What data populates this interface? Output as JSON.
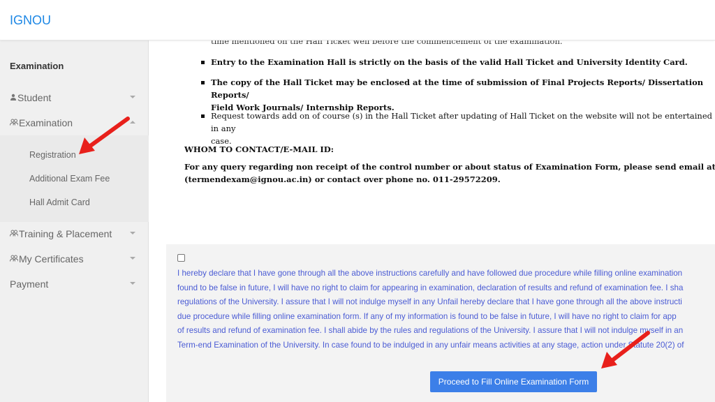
{
  "header": {
    "brand": "IGNOU"
  },
  "sidebar": {
    "heading": "Examination",
    "items": [
      {
        "label": "Student",
        "icon": "user-icon"
      },
      {
        "label": "Examination",
        "icon": "group-icon"
      },
      {
        "label": "Training & Placement",
        "icon": "group-icon"
      },
      {
        "label": "My Certificates",
        "icon": "group-icon"
      },
      {
        "label": "Payment",
        "icon": ""
      }
    ],
    "subitems": [
      {
        "label": "Registration"
      },
      {
        "label": "Additional Exam Fee"
      },
      {
        "label": "Hall Admit Card"
      }
    ]
  },
  "document": {
    "cut_line": "time mentioned on the Hall Ticket well before the commencement of the examination.",
    "bullets": [
      {
        "text": "Entry to the Examination Hall is strictly on the basis of the valid Hall Ticket and University Identity Card.",
        "bold": true
      },
      {
        "text": "The copy of the Hall Ticket may be enclosed at the time of submission of Final Projects Reports/ Dissertation Reports/\nField Work Journals/ Internship Reports.",
        "bold": true
      },
      {
        "text": "Request towards add on of course (s) in the Hall Ticket after updating of Hall Ticket on the website will not be entertained in any\ncase.",
        "bold": false
      }
    ],
    "contact_heading": "WHOM TO CONTACT/E-MAIL ID:",
    "contact_body": "For any query regarding non receipt of the control number or about status of Examination Form, please send email at\n(termendexam@ignou.ac.in) or contact over phone no. 011-29572209."
  },
  "declaration": {
    "checked": false,
    "text": "I hereby declare that I have gone through all the above instructions carefully and have followed due procedure while filling online examination\nfound to be false in future, I will have no right to claim for appearing in examination, declaration of results and refund of examination fee. I sha\nregulations of the University. I assure that I will not indulge myself in any Unfail hereby declare that I have gone through all the above instructi\ndue procedure while filling online examination form. If any of my information is found to be false in future, I will have no right to claim for app\nof results and refund of examination fee. I shall abide by the rules and regulations of the University. I assure that I will not indulge myself in an\nTerm-end Examination of the University. In case found to be indulged in any unfair means activities at any stage, action under Statute 20(2) of",
    "button_label": "Proceed to Fill Online Examination Form"
  },
  "colors": {
    "brand": "#1e88e5",
    "link_text": "#4a5bd4",
    "button": "#3c7fe8",
    "annotation_arrow": "#e8201b"
  }
}
